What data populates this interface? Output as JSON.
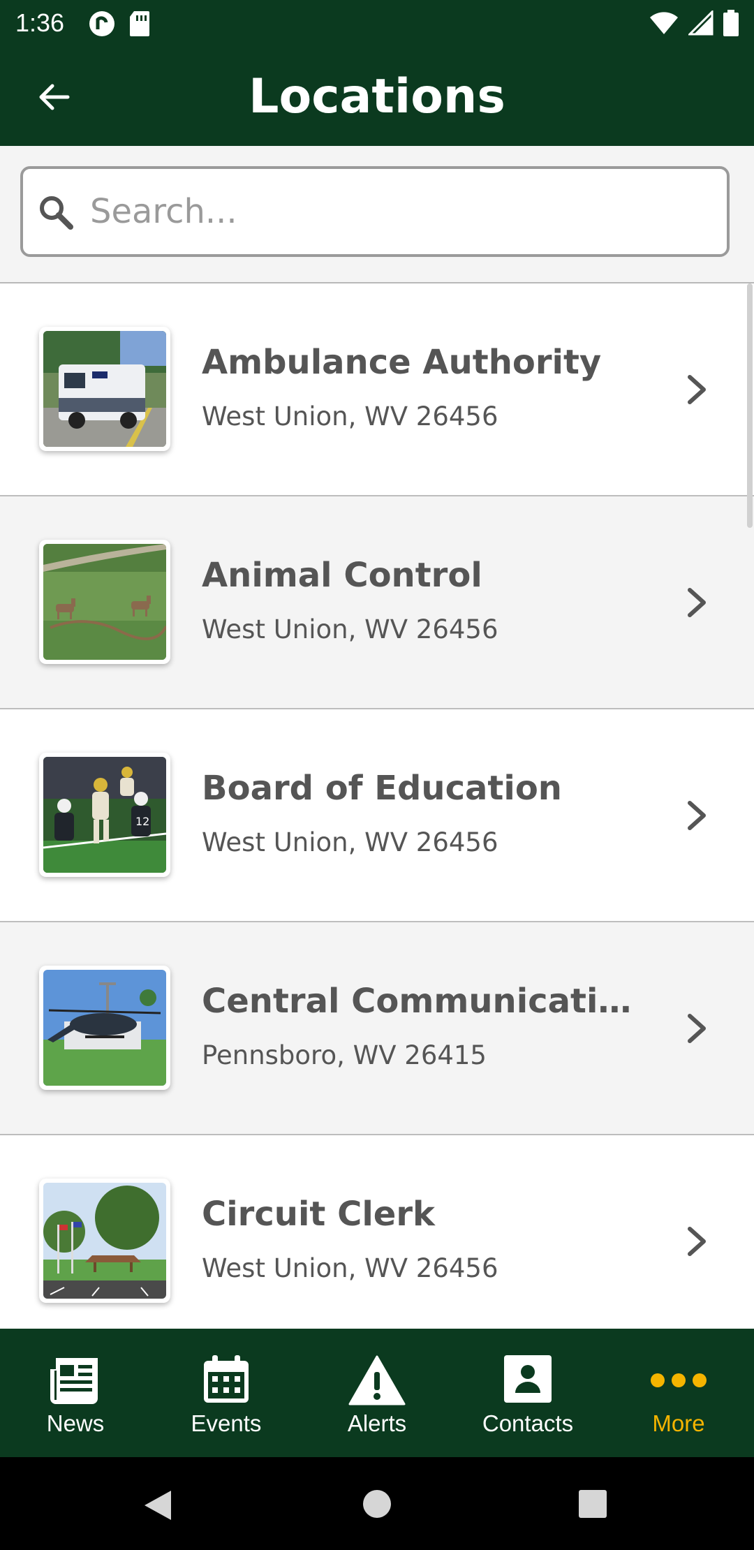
{
  "status_bar": {
    "time": "1:36",
    "left_icons": [
      "pocket-casts-icon",
      "sd-card-icon"
    ],
    "right_icons": [
      "wifi-icon",
      "signal-icon",
      "battery-icon"
    ]
  },
  "header": {
    "title": "Locations",
    "back_icon": "arrow-left-icon"
  },
  "search": {
    "placeholder": "Search...",
    "value": ""
  },
  "locations": [
    {
      "title": "Ambulance Authority",
      "subtitle": "West Union, WV 26456"
    },
    {
      "title": "Animal Control",
      "subtitle": "West Union, WV 26456"
    },
    {
      "title": "Board of Education",
      "subtitle": "West Union, WV 26456"
    },
    {
      "title": "Central Communications, In...",
      "subtitle": "Pennsboro, WV 26415"
    },
    {
      "title": "Circuit Clerk",
      "subtitle": "West Union, WV 26456"
    }
  ],
  "bottom_nav": {
    "items": [
      {
        "label": "News",
        "icon": "newspaper-icon"
      },
      {
        "label": "Events",
        "icon": "calendar-icon"
      },
      {
        "label": "Alerts",
        "icon": "warning-icon"
      },
      {
        "label": "Contacts",
        "icon": "contact-card-icon"
      },
      {
        "label": "More",
        "icon": "more-dots-icon",
        "active": true
      }
    ]
  },
  "colors": {
    "brand_green": "#0b3a1f",
    "active_accent": "#f5b400"
  }
}
